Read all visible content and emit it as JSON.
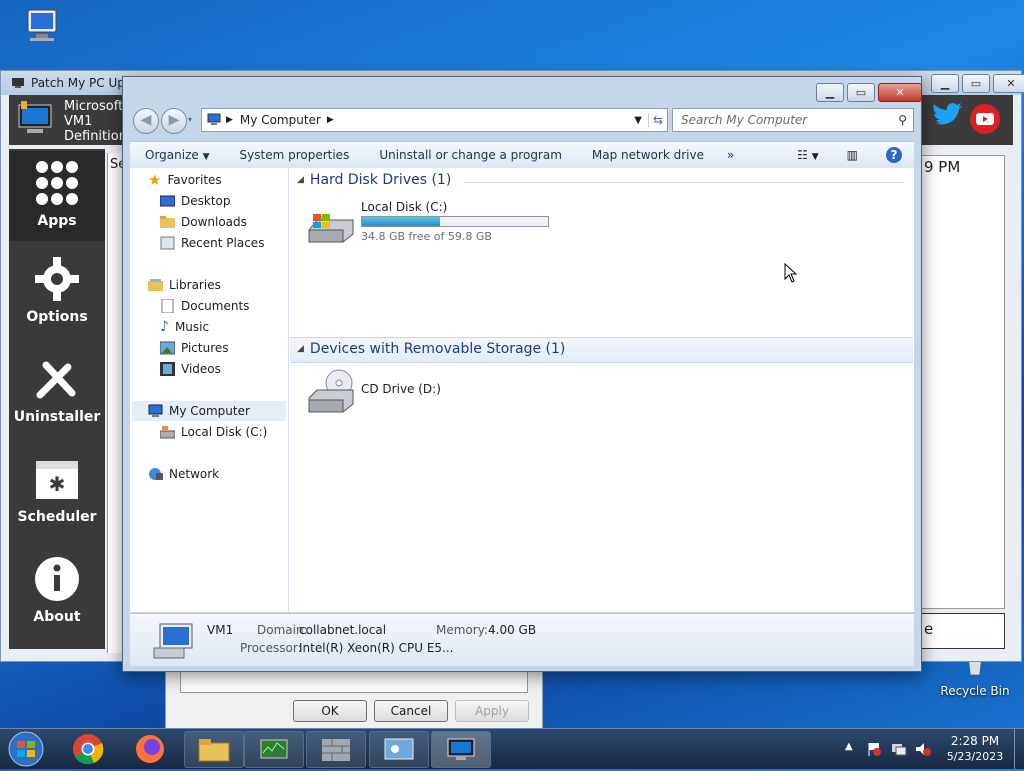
{
  "desktop": {
    "icons": [
      {
        "label": "My Computer"
      },
      {
        "label": "Recycle Bin"
      }
    ]
  },
  "patch_window": {
    "title": "Patch My PC Upd",
    "header_lines": [
      "Microsoft",
      "VM1",
      "Definition"
    ],
    "time_fragment": "9 PM",
    "search_fragment": "Se",
    "right_box_text": "e",
    "sidebar": [
      {
        "label": "Apps",
        "icon": "apps-grid-icon"
      },
      {
        "label": "Options",
        "icon": "gear-icon"
      },
      {
        "label": "Uninstaller",
        "icon": "wrench-icon"
      },
      {
        "label": "Scheduler",
        "icon": "calendar-icon"
      },
      {
        "label": "About",
        "icon": "info-icon"
      }
    ]
  },
  "dialog": {
    "ok": "OK",
    "cancel": "Cancel",
    "apply": "Apply"
  },
  "explorer": {
    "address": "My Computer",
    "search_placeholder": "Search My Computer",
    "commands": [
      "Organize",
      "System properties",
      "Uninstall or change a program",
      "Map network drive",
      "»"
    ],
    "nav": {
      "favorites": "Favorites",
      "favorites_items": [
        "Desktop",
        "Downloads",
        "Recent Places"
      ],
      "libraries": "Libraries",
      "libraries_items": [
        "Documents",
        "Music",
        "Pictures",
        "Videos"
      ],
      "computer": "My Computer",
      "computer_items": [
        "Local Disk (C:)"
      ],
      "network": "Network"
    },
    "groups": {
      "hdd_title": "Hard Disk Drives (1)",
      "removable_title": "Devices with Removable Storage (1)"
    },
    "drives": {
      "c_name": "Local Disk (C:)",
      "c_free": "34.8 GB free of 59.8 GB",
      "c_used_fraction": 0.418,
      "d_name": "CD Drive (D:)"
    },
    "details": {
      "name": "VM1",
      "domain_label": "Domain:",
      "domain": "collabnet.local",
      "memory_label": "Memory:",
      "memory": "4.00 GB",
      "processor_label": "Processor:",
      "processor": "Intel(R) Xeon(R) CPU E5..."
    }
  },
  "taskbar": {
    "time": "2:28 PM",
    "date": "5/23/2023"
  },
  "colors": {
    "accent": "#1e3a8a",
    "progress": "#26a0da"
  }
}
